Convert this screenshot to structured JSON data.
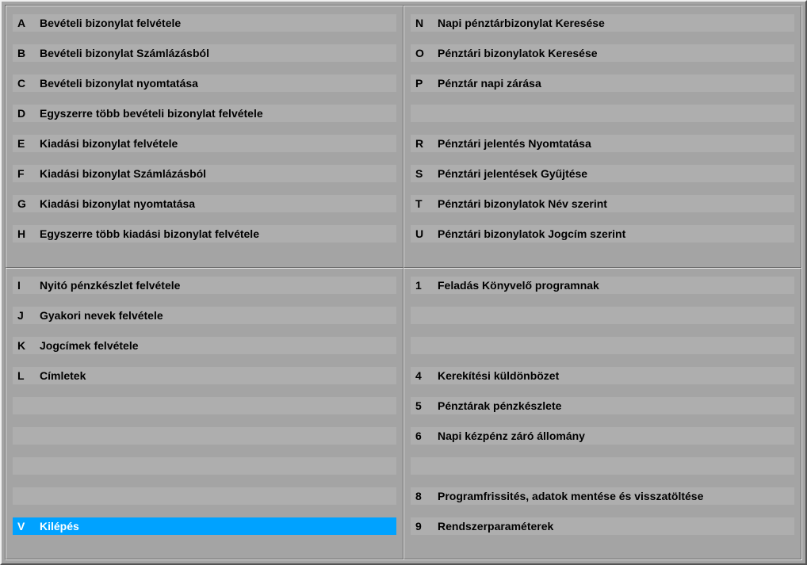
{
  "panels": [
    {
      "id": "top-left",
      "rows": [
        {
          "key": "A",
          "label": "Bevételi bizonylat felvétele"
        },
        {
          "key": "B",
          "label": "Bevételi bizonylat Számlázásból"
        },
        {
          "key": "C",
          "label": "Bevételi bizonylat nyomtatása"
        },
        {
          "key": "D",
          "label": "Egyszerre több bevételi bizonylat felvétele"
        },
        {
          "key": "E",
          "label": "Kiadási bizonylat felvétele"
        },
        {
          "key": "F",
          "label": "Kiadási bizonylat Számlázásból"
        },
        {
          "key": "G",
          "label": "Kiadási bizonylat nyomtatása"
        },
        {
          "key": "H",
          "label": "Egyszerre több kiadási bizonylat felvétele"
        }
      ]
    },
    {
      "id": "top-right",
      "rows": [
        {
          "key": "N",
          "label": "Napi pénztárbizonylat Keresése"
        },
        {
          "key": "O",
          "label": "Pénztári bizonylatok Keresése"
        },
        {
          "key": "P",
          "label": "Pénztár napi zárása"
        },
        {
          "key": "",
          "label": ""
        },
        {
          "key": "R",
          "label": "Pénztári jelentés Nyomtatása"
        },
        {
          "key": "S",
          "label": "Pénztári jelentések Gyűjtése"
        },
        {
          "key": "T",
          "label": "Pénztári bizonylatok Név szerint"
        },
        {
          "key": "U",
          "label": "Pénztári bizonylatok Jogcím szerint"
        }
      ]
    },
    {
      "id": "bottom-left",
      "rows": [
        {
          "key": "I",
          "label": "Nyitó pénzkészlet felvétele"
        },
        {
          "key": "J",
          "label": "Gyakori nevek felvétele"
        },
        {
          "key": "K",
          "label": "Jogcímek felvétele"
        },
        {
          "key": "L",
          "label": "Címletek"
        },
        {
          "key": "",
          "label": ""
        },
        {
          "key": "",
          "label": ""
        },
        {
          "key": "",
          "label": ""
        },
        {
          "key": "",
          "label": ""
        },
        {
          "key": "V",
          "label": "Kilépés",
          "selected": true
        }
      ]
    },
    {
      "id": "bottom-right",
      "rows": [
        {
          "key": "1",
          "label": "Feladás Könyvelő programnak"
        },
        {
          "key": "",
          "label": ""
        },
        {
          "key": "",
          "label": ""
        },
        {
          "key": "4",
          "label": "Kerekítési küldönbözet"
        },
        {
          "key": "5",
          "label": "Pénztárak pénzkészlete"
        },
        {
          "key": "6",
          "label": "Napi kézpénz záró állomány"
        },
        {
          "key": "",
          "label": ""
        },
        {
          "key": "8",
          "label": "Programfrissités, adatok mentése és visszatöltése"
        },
        {
          "key": "9",
          "label": "Rendszerparaméterek"
        }
      ]
    }
  ]
}
